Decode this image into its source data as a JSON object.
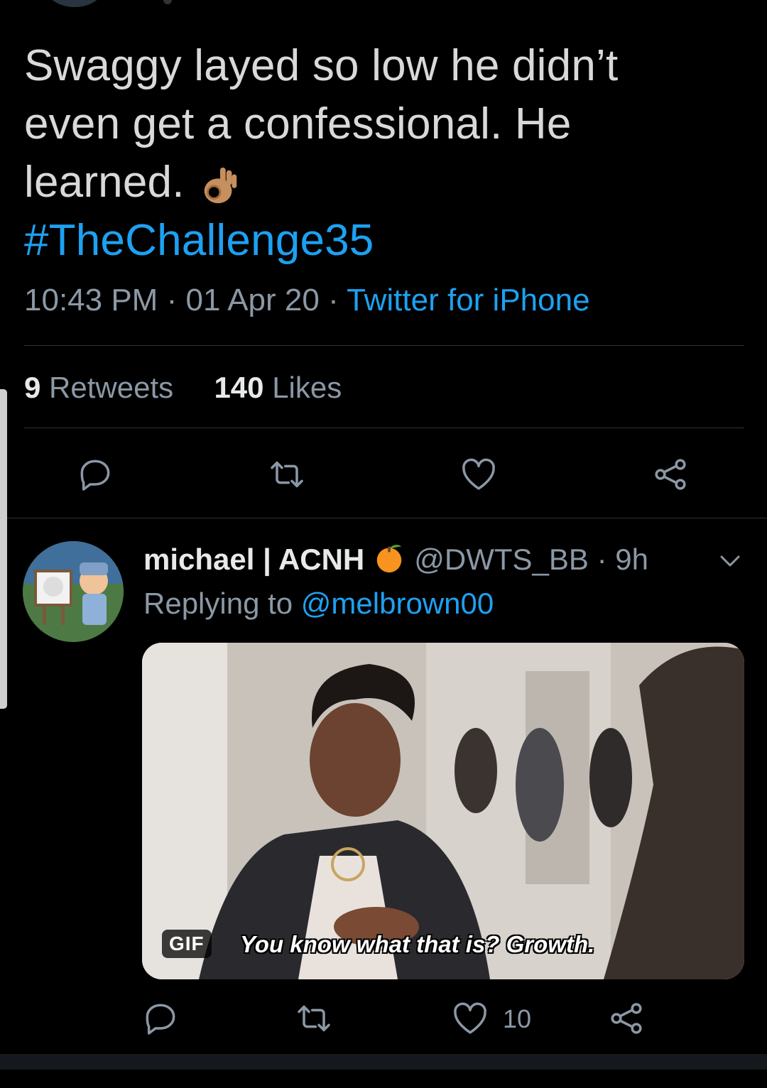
{
  "tweet": {
    "text_lines": [
      "Swaggy layed so low he didn’t",
      "even get a confessional. He",
      "learned."
    ],
    "emoji": "ok-hand-emoji",
    "hashtag": "#TheChallenge35",
    "time": "10:43 PM",
    "date": "01 Apr 20",
    "source": "Twitter for iPhone",
    "separator": "·",
    "retweets_count": "9",
    "retweets_label": "Retweets",
    "likes_count": "140",
    "likes_label": "Likes"
  },
  "actions": [
    "reply-icon",
    "retweet-icon",
    "like-icon",
    "share-icon"
  ],
  "reply": {
    "name": "michael | ACNH",
    "name_emoji": "tangerine-emoji",
    "handle": "@DWTS_BB",
    "time": "· 9h",
    "replying_prefix": "Replying to",
    "replying_to": "@melbrown00",
    "gif_badge": "GIF",
    "gif_caption": "You know what that is? Growth.",
    "like_count": "10"
  },
  "colors": {
    "background": "#000000",
    "text": "#d9d9d9",
    "secondary": "#8b98a5",
    "accent": "#1da1f2",
    "divider": "#2f3336"
  }
}
